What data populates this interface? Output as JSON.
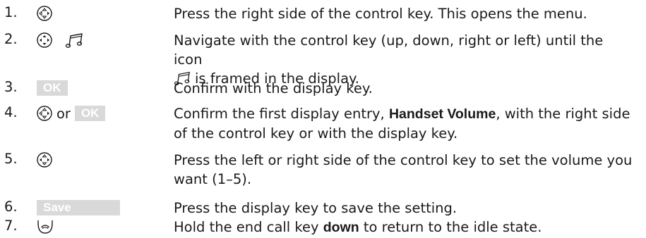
{
  "steps": [
    {
      "num": "1.",
      "keys": [
        "control-key"
      ],
      "text": "Press the right side of the control key. This opens the menu."
    },
    {
      "num": "2.",
      "keys": [
        "control-key",
        "music-note-icon"
      ],
      "text_a": "Navigate with the control key (up, down, right or left) until the icon",
      "text_b": "is framed in the display."
    },
    {
      "num": "3.",
      "key_label": "OK",
      "text": "Confirm with the display key."
    },
    {
      "num": "4.",
      "or_label": "or",
      "key_label": "OK",
      "text_a": "Confirm the first display entry, ",
      "text_bold": "Handset Volume",
      "text_b": ", with the right side of the control key or with the display key."
    },
    {
      "num": "5.",
      "text": "Press the left or right side of the control key to set the volume you want (1–5)."
    },
    {
      "num": "6.",
      "key_label": "Save",
      "text": "Press the display key to save the setting."
    },
    {
      "num": "7.",
      "text_a": "Hold the end call key ",
      "text_bold": "down",
      "text_b": " to return to the idle state."
    }
  ]
}
